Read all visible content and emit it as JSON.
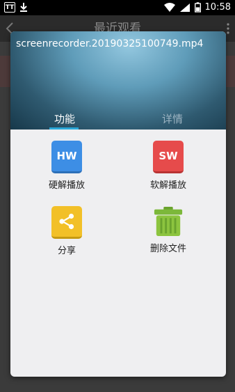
{
  "statusbar": {
    "app_badge": "TT",
    "time": "10:58",
    "battery_level": 0.5
  },
  "background_app": {
    "title": "最近观看"
  },
  "dialog": {
    "file_name": "screenrecorder.20190325100749.mp4",
    "tabs": [
      {
        "label": "功能",
        "active": true
      },
      {
        "label": "详情",
        "active": false
      }
    ],
    "actions": [
      {
        "label": "硬解播放",
        "icon_text": "HW",
        "icon": "hw-icon",
        "color": "#3d8ee5"
      },
      {
        "label": "软解播放",
        "icon_text": "SW",
        "icon": "sw-icon",
        "color": "#e64b4b"
      },
      {
        "label": "分享",
        "icon": "share-icon",
        "color": "#f2c028"
      },
      {
        "label": "删除文件",
        "icon": "trash-icon",
        "color": "#7cb83a"
      }
    ]
  }
}
